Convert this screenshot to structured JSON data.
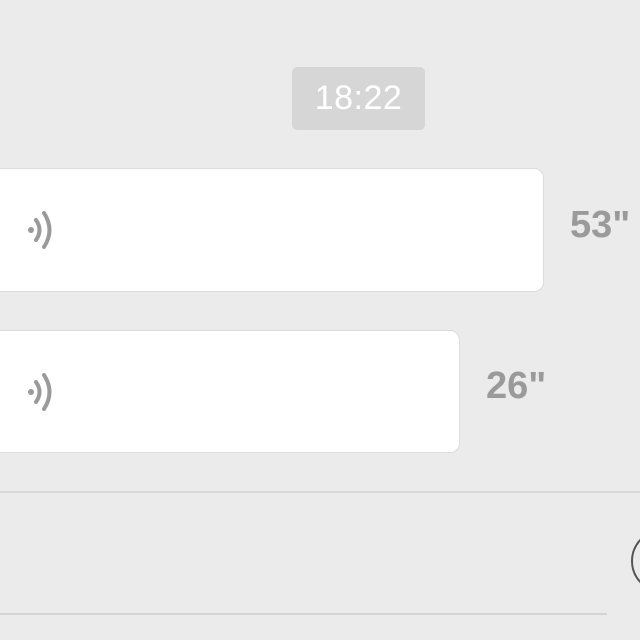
{
  "chat": {
    "timestamp": "18:22",
    "messages": [
      {
        "type": "voice",
        "icon": "voice-wave-icon",
        "duration": "53\""
      },
      {
        "type": "voice",
        "icon": "voice-wave-icon",
        "duration": "26\""
      }
    ]
  },
  "input_bar": {
    "right_button_icon": "circle-button-icon"
  },
  "colors": {
    "background": "#ebebeb",
    "bubble": "#ffffff",
    "timestamp_bg": "#d6d6d6",
    "duration_text": "#9a9a9a",
    "icon": "#9a9a9a"
  }
}
